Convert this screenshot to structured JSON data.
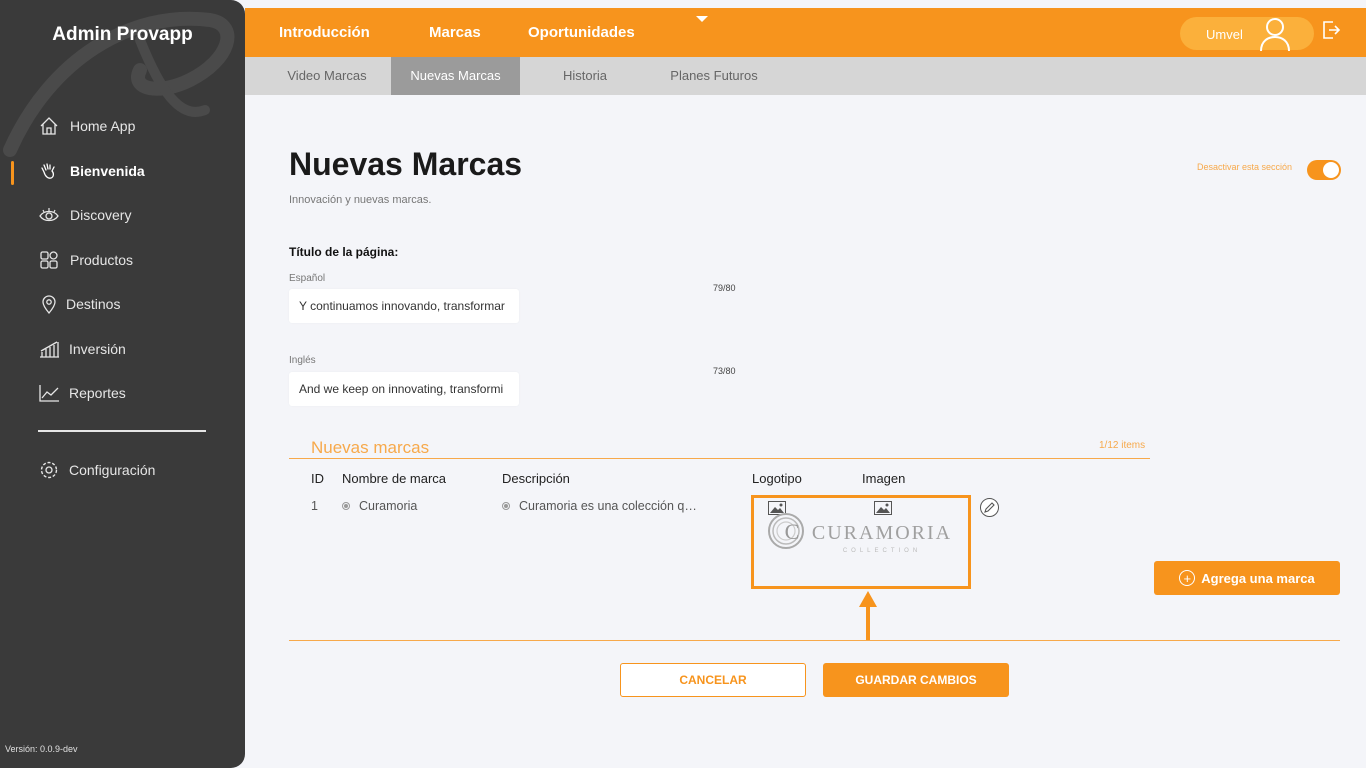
{
  "app": {
    "title": "Admin Provapp",
    "version": "Versión: 0.0.9-dev"
  },
  "sidebar": {
    "items": [
      {
        "label": "Home App",
        "icon": "home-icon"
      },
      {
        "label": "Bienvenida",
        "icon": "waving-hand-icon",
        "active": true
      },
      {
        "label": "Discovery",
        "icon": "eye-icon"
      },
      {
        "label": "Productos",
        "icon": "grid-icon"
      },
      {
        "label": "Destinos",
        "icon": "location-pin-icon"
      },
      {
        "label": "Inversión",
        "icon": "bar-chart-icon"
      },
      {
        "label": "Reportes",
        "icon": "line-chart-icon"
      }
    ],
    "settings": {
      "label": "Configuración",
      "icon": "gear-icon"
    }
  },
  "topbar": {
    "tabs": [
      {
        "label": "Introducción"
      },
      {
        "label": "Marcas",
        "active": true
      },
      {
        "label": "Oportunidades"
      }
    ],
    "user": {
      "name": "Umvel"
    }
  },
  "subnav": {
    "tabs": [
      {
        "label": "Video Marcas"
      },
      {
        "label": "Nuevas Marcas",
        "active": true
      },
      {
        "label": "Historia"
      },
      {
        "label": "Planes Futuros"
      }
    ]
  },
  "page": {
    "title": "Nuevas Marcas",
    "subtitle": "Innovación y nuevas marcas.",
    "toggle_label": "Desactivar esta sección",
    "toggle_on": true
  },
  "form": {
    "section_label": "Título de la página:",
    "spanish": {
      "label": "Español",
      "value": "Y continuamos innovando, transformar",
      "counter": "79/80"
    },
    "english": {
      "label": "Inglés",
      "value": "And we keep on innovating, transformi",
      "counter": "73/80"
    }
  },
  "brands": {
    "title": "Nuevas marcas",
    "count": "1/12 items",
    "columns": [
      "ID",
      "Nombre de marca",
      "Descripción",
      "Logotipo",
      "Imagen"
    ],
    "rows": [
      {
        "id": "1",
        "name": "Curamoria",
        "description": "Curamoria es una colección q…"
      }
    ],
    "logo_text": "CURAMORIA",
    "logo_sub": "COLLECTION",
    "add_label": "Agrega una marca"
  },
  "actions": {
    "cancel": "CANCELAR",
    "save": "GUARDAR CAMBIOS"
  },
  "colors": {
    "accent": "#f7941d",
    "sidebar": "#3a3a3a",
    "background": "#f4f5f9"
  }
}
